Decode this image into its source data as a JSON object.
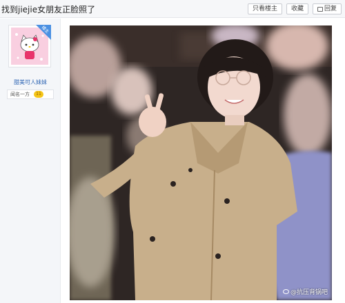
{
  "header": {
    "title": "找到jiejie女朋友正脸照了",
    "buttons": [
      {
        "label": "只看楼主"
      },
      {
        "label": "收藏"
      },
      {
        "label": "回复",
        "icon": "reply-icon"
      }
    ]
  },
  "sidebar": {
    "avatar_icon": "hello-kitty-avatar",
    "corner_badge": "楼主",
    "username": "甜美可人妹妹",
    "level_title": "闻名一方",
    "level_number": "11"
  },
  "post": {
    "image_description_icon": "photo",
    "watermark": "@抗压背锅吧"
  },
  "colors": {
    "accent": "#2d64b3",
    "badge_blue": "#4a90e2",
    "coat": "#c9b08c",
    "level_gold": "#f5c518"
  }
}
